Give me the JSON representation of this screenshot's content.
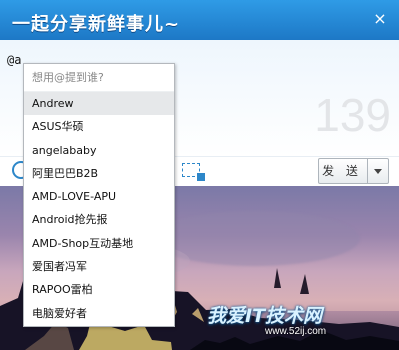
{
  "window": {
    "title": "一起分享新鲜事儿~",
    "close_label": "×"
  },
  "compose": {
    "text": "@a",
    "counter": "139"
  },
  "toolbar": {
    "send_label": "发 送",
    "emoji_icon": "emoji-icon",
    "image_icon": "image-icon",
    "send_arrow_icon": "chevron-down-icon"
  },
  "mention_popup": {
    "header": "想用@提到谁?",
    "items": [
      {
        "label": "Andrew",
        "active": true
      },
      {
        "label": "ASUS华硕"
      },
      {
        "label": "angelababy"
      },
      {
        "label": "阿里巴巴B2B"
      },
      {
        "label": "AMD-LOVE-APU"
      },
      {
        "label": "Android抢先报"
      },
      {
        "label": "AMD-Shop互动基地"
      },
      {
        "label": "爱国者冯军"
      },
      {
        "label": "RAPOO雷柏"
      },
      {
        "label": "电脑爱好者"
      }
    ]
  },
  "watermark": {
    "text": "我爱IT技术网",
    "sub": "www.52ij.com"
  },
  "colors": {
    "title_bar": "#1f7cc8",
    "accent": "#2d87c9",
    "popup_border": "#b4b8bd",
    "active_item": "#e6e8ea"
  }
}
